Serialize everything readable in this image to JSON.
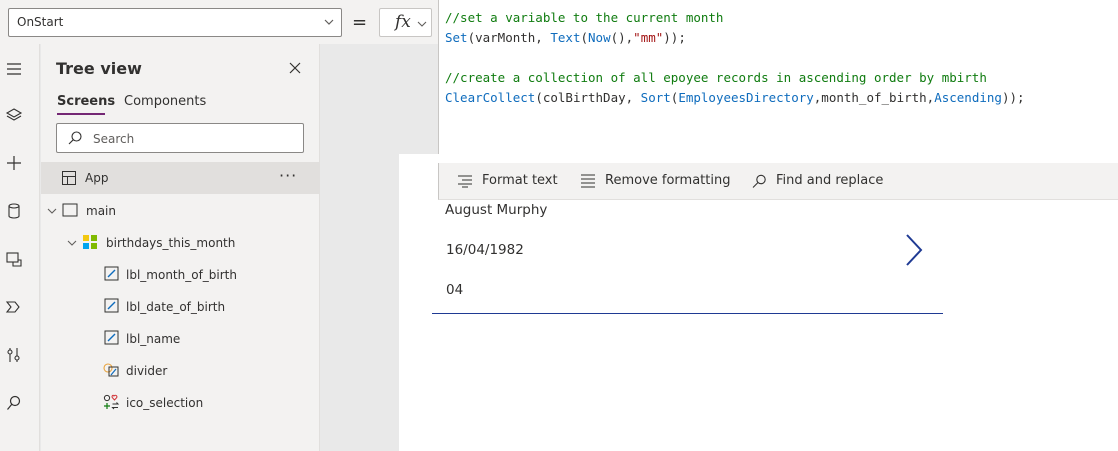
{
  "formula_bar": {
    "property": "OnStart",
    "equals": "=",
    "fx": "fx",
    "lines": [
      {
        "tokens": [
          {
            "t": "//set a variable to the current month",
            "k": "comment"
          }
        ]
      },
      {
        "tokens": [
          {
            "t": "Set",
            "k": "fn"
          },
          {
            "t": "(varMonth, ",
            "k": "plain"
          },
          {
            "t": "Text",
            "k": "fn"
          },
          {
            "t": "(",
            "k": "plain"
          },
          {
            "t": "Now",
            "k": "fn"
          },
          {
            "t": "(),",
            "k": "plain"
          },
          {
            "t": "\"mm\"",
            "k": "str"
          },
          {
            "t": "));",
            "k": "plain"
          }
        ]
      },
      {
        "tokens": []
      },
      {
        "tokens": [
          {
            "t": "//create a collection of all epoyee records in ascending order by mbirth",
            "k": "comment"
          }
        ]
      },
      {
        "tokens": [
          {
            "t": "ClearCollect",
            "k": "fn"
          },
          {
            "t": "(colBirthDay, ",
            "k": "plain"
          },
          {
            "t": "Sort",
            "k": "fn"
          },
          {
            "t": "(",
            "k": "plain"
          },
          {
            "t": "EmployeesDirectory",
            "k": "fn"
          },
          {
            "t": ",month_of_birth,",
            "k": "plain"
          },
          {
            "t": "Ascending",
            "k": "fn"
          },
          {
            "t": "));",
            "k": "plain"
          }
        ]
      }
    ]
  },
  "format_toolbar": {
    "format_text": "Format text",
    "remove_formatting": "Remove formatting",
    "find_replace": "Find and replace"
  },
  "tree_view": {
    "title": "Tree view",
    "tabs": {
      "screens": "Screens",
      "components": "Components"
    },
    "search_placeholder": "Search",
    "app_label": "App",
    "more": "···",
    "nodes": {
      "main": "main",
      "gallery": "birthdays_this_month",
      "lbl_month": "lbl_month_of_birth",
      "lbl_date": "lbl_date_of_birth",
      "lbl_name": "lbl_name",
      "divider": "divider",
      "ico_selection": "ico_selection"
    }
  },
  "gallery": {
    "name": "August Murphy",
    "date": "16/04/1982",
    "month": "04"
  },
  "colors": {
    "accent": "#742774",
    "comment": "#107c10",
    "function": "#0f6cbd",
    "string": "#a31515",
    "divider": "#1f3a93"
  }
}
